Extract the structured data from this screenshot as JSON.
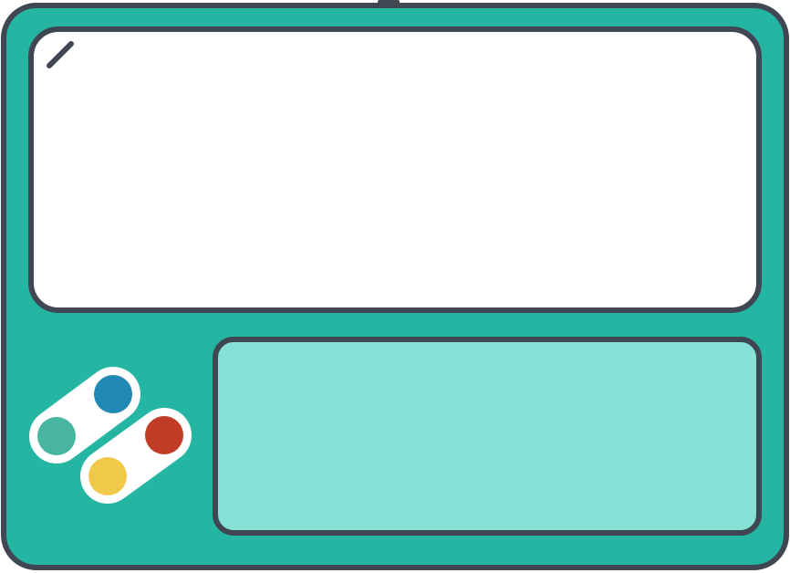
{
  "colors": {
    "body": "#24B5A3",
    "outline": "#414752",
    "screen": "#FFFFFF",
    "touchpad": "#86E1D7",
    "button_bg": "#FFFFFF",
    "button_blue": "#2289B5",
    "button_green": "#47B59F",
    "button_red": "#C13C26",
    "button_yellow": "#F0C94B"
  },
  "icons": {
    "screen_glare": "glare-line-icon",
    "buttons": [
      "blue-button-icon",
      "green-button-icon",
      "red-button-icon",
      "yellow-button-icon"
    ]
  }
}
